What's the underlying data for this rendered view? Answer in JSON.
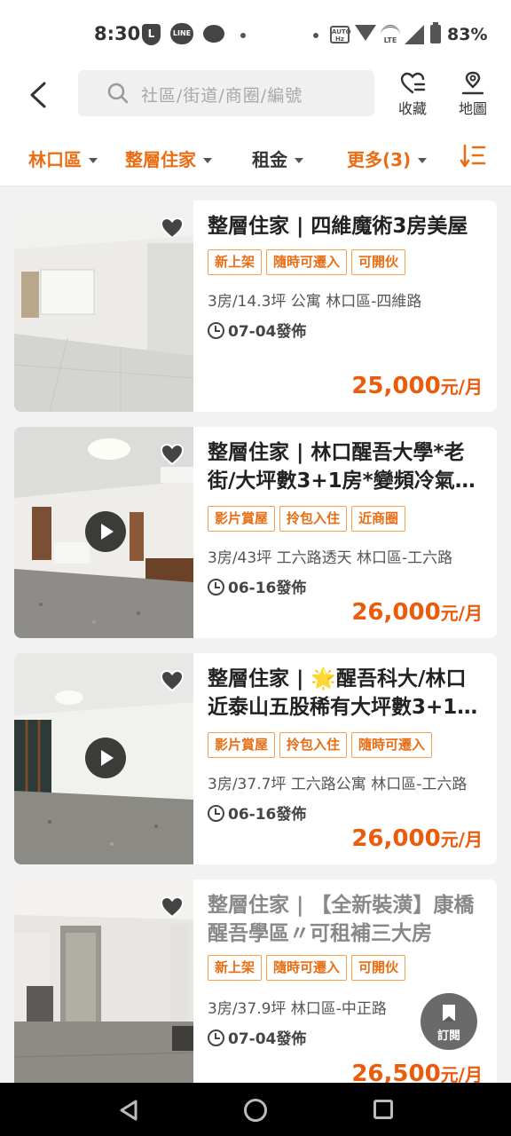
{
  "status_bar": {
    "time": "8:30",
    "battery": "83%",
    "l_badge": "L",
    "line_badge": "LINE",
    "auto_label": "AUTO Hz",
    "lte_label": "LTE"
  },
  "header": {
    "search_placeholder": "社區/街道/商圈/編號",
    "favorites_label": "收藏",
    "map_label": "地圖"
  },
  "filters": [
    {
      "label": "林口區",
      "active": true
    },
    {
      "label": "整層住家",
      "active": true
    },
    {
      "label": "租金",
      "active": false
    },
    {
      "label": "更多(3)",
      "active": true
    }
  ],
  "colors": {
    "accent": "#ea5b0c",
    "tag_border": "#f5a04c"
  },
  "listings": [
    {
      "title": "整層住家 | 四維魔術3房美屋",
      "tags": [
        "新上架",
        "隨時可遷入",
        "可開伙"
      ],
      "info": "3房/14.3坪  公寓  林口區-四維路",
      "posted": "07-04發佈",
      "price": "25,000",
      "price_unit": "元/月",
      "has_video": false
    },
    {
      "title": "整層住家 | 林口醒吾大學*老街/大坪數3+1房*變頻冷氣…",
      "tags": [
        "影片賞屋",
        "拎包入住",
        "近商圈"
      ],
      "info": "3房/43坪  工六路透天  林口區-工六路",
      "posted": "06-16發佈",
      "price": "26,000",
      "price_unit": "元/月",
      "has_video": true
    },
    {
      "title": "整層住家 | 🌟醒吾科大/林口近泰山五股稀有大坪數3+1…",
      "tags": [
        "影片賞屋",
        "拎包入住",
        "隨時可遷入"
      ],
      "info": "3房/37.7坪  工六路公寓  林口區-工六路",
      "posted": "06-16發佈",
      "price": "26,000",
      "price_unit": "元/月",
      "has_video": true
    },
    {
      "title": "整層住家 | 【全新裝潢】康橋醒吾學區〃可租補三大房",
      "tags": [
        "新上架",
        "隨時可遷入",
        "可開伙"
      ],
      "info": "3房/37.9坪  林口區-中正路",
      "posted": "07-04發佈",
      "price": "26,500",
      "price_unit": "元/月",
      "has_video": false
    }
  ],
  "subscribe_label": "訂閱"
}
